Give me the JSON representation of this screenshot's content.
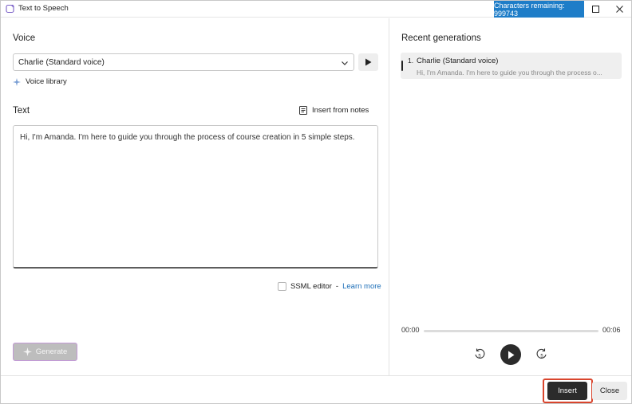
{
  "window": {
    "title": "Text to Speech",
    "characters_remaining": "Characters remaining: 999743"
  },
  "voice": {
    "label": "Voice",
    "selected": "Charlie (Standard voice)",
    "library_link": "Voice library"
  },
  "text": {
    "label": "Text",
    "insert_from_notes": "Insert from notes",
    "content": "Hi, I'm Amanda. I'm here to guide you through the process of course creation in 5 simple steps."
  },
  "ssml": {
    "label": "SSML editor",
    "separator": "-",
    "learn_more": "Learn more",
    "checked": false
  },
  "generate_label": "Generate",
  "recent": {
    "label": "Recent generations",
    "items": [
      {
        "number": "1.",
        "name": "Charlie (Standard voice)",
        "snippet": "Hi, I'm Amanda. I'm here to guide you through the process o..."
      }
    ]
  },
  "player": {
    "current_time": "00:00",
    "total_time": "00:06",
    "progress": 0
  },
  "footer": {
    "insert_label": "Insert",
    "close_label": "Close"
  },
  "colors": {
    "accent": "#1e7dc8",
    "highlight": "#d9452d",
    "link": "#1e6fb8",
    "dark_button": "#2b2b2b"
  }
}
